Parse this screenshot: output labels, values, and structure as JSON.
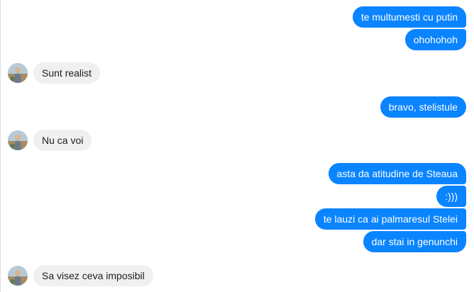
{
  "conversation": {
    "messages": [
      {
        "direction": "out",
        "text": "te multumesti cu putin"
      },
      {
        "direction": "out",
        "text": "ohohohoh"
      },
      {
        "direction": "in",
        "text": "Sunt realist"
      },
      {
        "direction": "out",
        "text": "bravo, stelistule"
      },
      {
        "direction": "in",
        "text": "Nu ca voi"
      },
      {
        "direction": "out",
        "text": "asta da atitudine de Steaua"
      },
      {
        "direction": "out",
        "text": ":)))"
      },
      {
        "direction": "out",
        "text": "te lauzi ca ai palmaresul Stelei"
      },
      {
        "direction": "out",
        "text": "dar stai in genunchi"
      },
      {
        "direction": "in",
        "text": "Sa visez ceva imposibil"
      }
    ]
  },
  "colors": {
    "outgoing_bubble": "#0a84ff",
    "incoming_bubble": "#f1f0f0"
  },
  "icons": {
    "avatar": "contact-avatar-photo"
  }
}
